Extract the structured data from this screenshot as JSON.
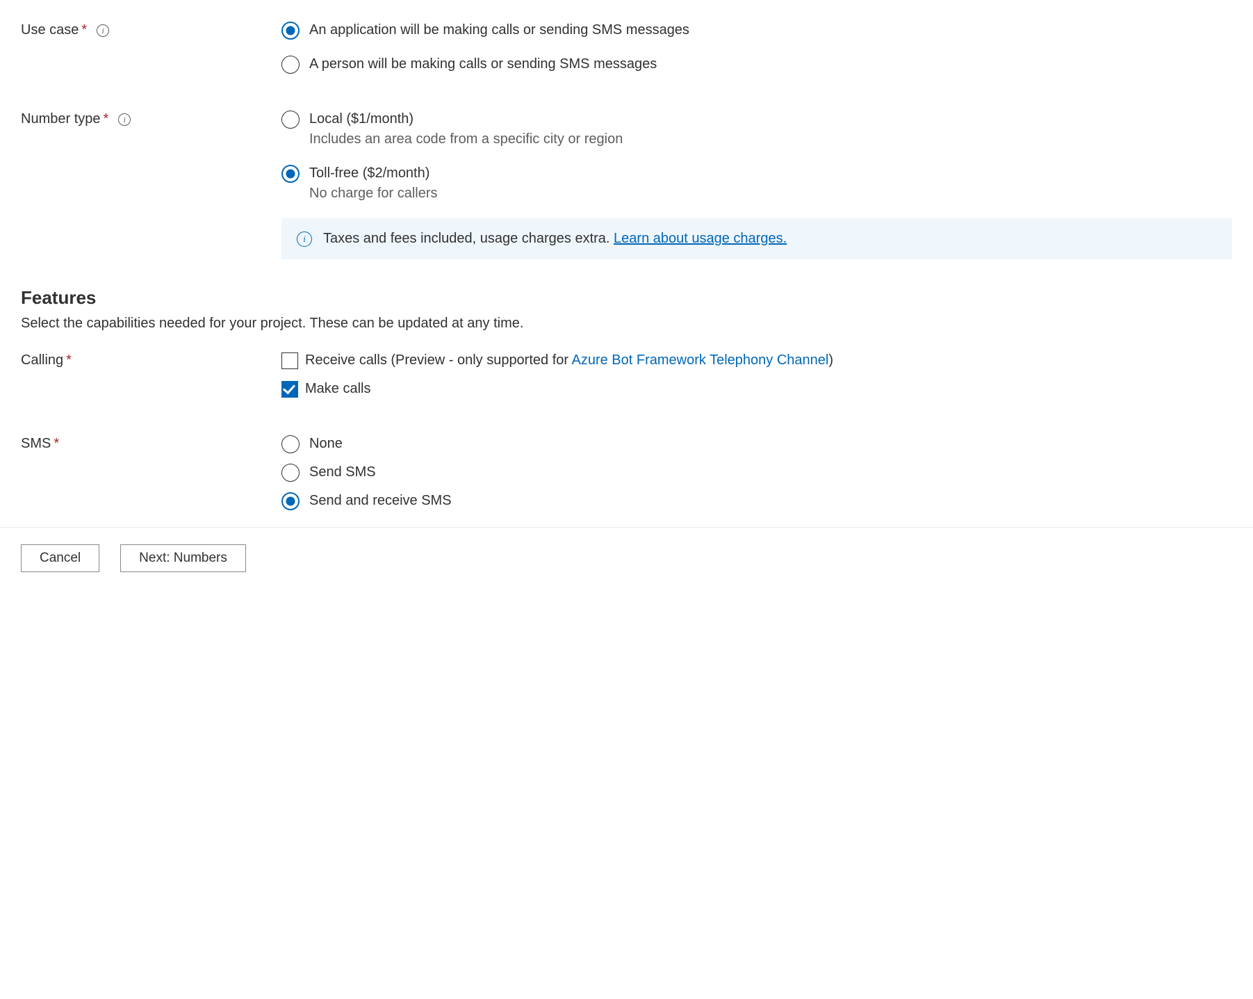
{
  "useCase": {
    "label": "Use case",
    "options": {
      "app": "An application will be making calls or sending SMS messages",
      "person": "A person will be making calls or sending SMS messages"
    }
  },
  "numberType": {
    "label": "Number type",
    "options": {
      "local": {
        "label": "Local ($1/month)",
        "sub": "Includes an area code from a specific city or region"
      },
      "tollfree": {
        "label": "Toll-free ($2/month)",
        "sub": "No charge for callers"
      }
    },
    "notice": {
      "text": "Taxes and fees included, usage charges extra. ",
      "link": "Learn about usage charges."
    }
  },
  "features": {
    "title": "Features",
    "desc": "Select the capabilities needed for your project. These can be updated at any time."
  },
  "calling": {
    "label": "Calling",
    "receivePrefix": "Receive calls (Preview - only supported for ",
    "receiveLink": "Azure Bot Framework Telephony Channel",
    "receiveSuffix": ")",
    "make": "Make calls"
  },
  "sms": {
    "label": "SMS",
    "options": {
      "none": "None",
      "send": "Send SMS",
      "sendRecv": "Send and receive SMS"
    }
  },
  "footer": {
    "cancel": "Cancel",
    "next": "Next: Numbers"
  }
}
